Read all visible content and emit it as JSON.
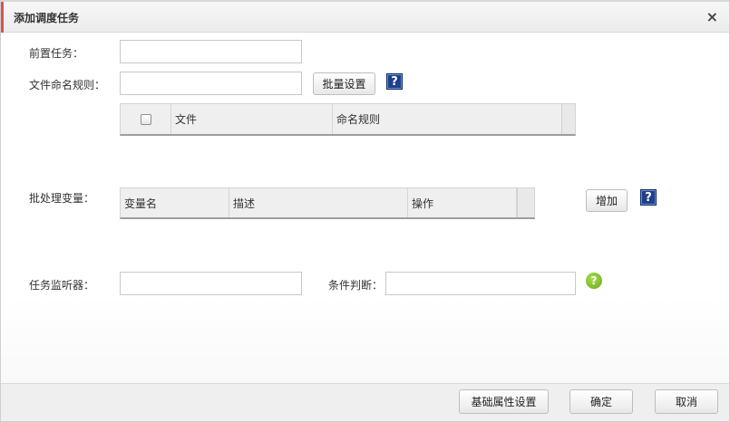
{
  "dialog": {
    "title": "添加调度任务",
    "close_symbol": "×"
  },
  "form": {
    "predecessor_label": "前置任务：",
    "predecessor_value": "",
    "naming_rule_label": "文件命名规则：",
    "naming_rule_value": "",
    "batch_set_button": "批量设置",
    "help_symbol": "?",
    "file_table": {
      "columns": [
        "文件",
        "命名规则"
      ]
    },
    "batch_var_label": "批处理变量：",
    "var_table": {
      "columns": [
        "变量名",
        "描述",
        "操作"
      ]
    },
    "add_button": "增加",
    "listener_label": "任务监听器：",
    "listener_value": "",
    "condition_label": "条件判断：",
    "condition_value": ""
  },
  "footer": {
    "basic_props_button": "基础属性设置",
    "ok_button": "确定",
    "cancel_button": "取消"
  },
  "colors": {
    "help_blue": "#1f3f8a",
    "help_green": "#7ab82a",
    "title_accent": "#d9534f"
  }
}
